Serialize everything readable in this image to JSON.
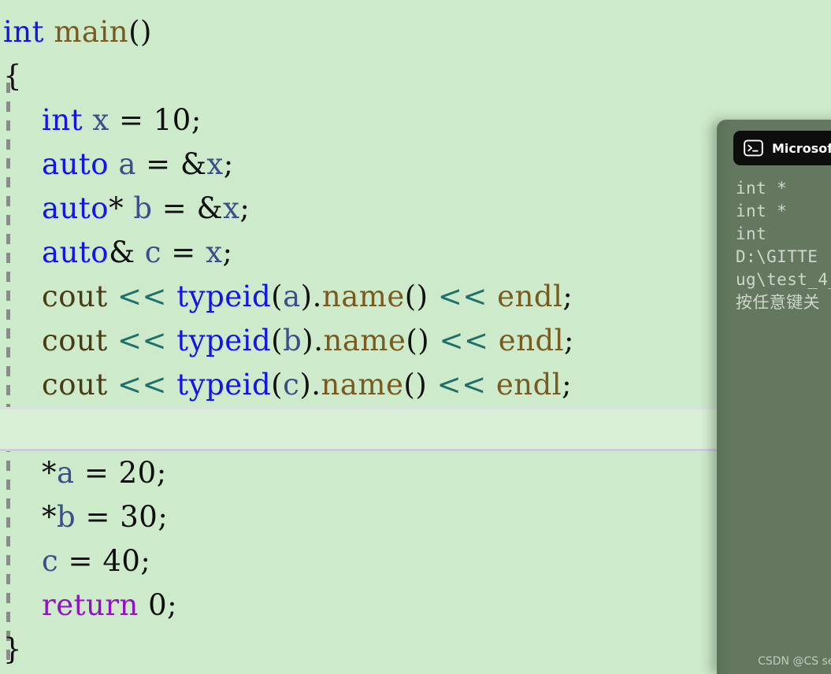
{
  "editor": {
    "background_color": "#cdeaca",
    "current_line_color": "#d9f0d6",
    "lines": [
      {
        "id": "l1",
        "indent": 0,
        "current": false,
        "tokens": [
          {
            "t": "int",
            "c": "k-type"
          },
          {
            "t": " ",
            "c": "op"
          },
          {
            "t": "main",
            "c": "ident"
          },
          {
            "t": "()",
            "c": "punc"
          }
        ]
      },
      {
        "id": "l2",
        "indent": 0,
        "current": false,
        "tokens": [
          {
            "t": "{",
            "c": "punc"
          }
        ]
      },
      {
        "id": "l3",
        "indent": 1,
        "current": false,
        "tokens": [
          {
            "t": "    ",
            "c": "op"
          },
          {
            "t": "int",
            "c": "k-type"
          },
          {
            "t": " ",
            "c": "op"
          },
          {
            "t": "x",
            "c": "var"
          },
          {
            "t": " = ",
            "c": "op"
          },
          {
            "t": "10",
            "c": "num"
          },
          {
            "t": ";",
            "c": "punc"
          }
        ]
      },
      {
        "id": "l4",
        "indent": 1,
        "current": false,
        "tokens": [
          {
            "t": "    ",
            "c": "op"
          },
          {
            "t": "auto",
            "c": "k-type"
          },
          {
            "t": " ",
            "c": "op"
          },
          {
            "t": "a",
            "c": "var"
          },
          {
            "t": " = ",
            "c": "op"
          },
          {
            "t": "&",
            "c": "op"
          },
          {
            "t": "x",
            "c": "var"
          },
          {
            "t": ";",
            "c": "punc"
          }
        ]
      },
      {
        "id": "l5",
        "indent": 1,
        "current": false,
        "tokens": [
          {
            "t": "    ",
            "c": "op"
          },
          {
            "t": "auto",
            "c": "k-type"
          },
          {
            "t": "*",
            "c": "op"
          },
          {
            "t": " ",
            "c": "op"
          },
          {
            "t": "b",
            "c": "var"
          },
          {
            "t": " = ",
            "c": "op"
          },
          {
            "t": "&",
            "c": "op"
          },
          {
            "t": "x",
            "c": "var"
          },
          {
            "t": ";",
            "c": "punc"
          }
        ]
      },
      {
        "id": "l6",
        "indent": 1,
        "current": false,
        "tokens": [
          {
            "t": "    ",
            "c": "op"
          },
          {
            "t": "auto",
            "c": "k-type"
          },
          {
            "t": "&",
            "c": "op"
          },
          {
            "t": " ",
            "c": "op"
          },
          {
            "t": "c",
            "c": "var"
          },
          {
            "t": " = ",
            "c": "op"
          },
          {
            "t": "x",
            "c": "var"
          },
          {
            "t": ";",
            "c": "punc"
          }
        ]
      },
      {
        "id": "l7",
        "indent": 1,
        "current": false,
        "tokens": [
          {
            "t": "    ",
            "c": "op"
          },
          {
            "t": "cout",
            "c": "cout"
          },
          {
            "t": " ",
            "c": "op"
          },
          {
            "t": "<<",
            "c": "shift"
          },
          {
            "t": " ",
            "c": "op"
          },
          {
            "t": "typeid",
            "c": "k-type"
          },
          {
            "t": "(",
            "c": "punc"
          },
          {
            "t": "a",
            "c": "var"
          },
          {
            "t": ")",
            "c": "punc"
          },
          {
            "t": ".",
            "c": "punc"
          },
          {
            "t": "name",
            "c": "ident"
          },
          {
            "t": "()",
            "c": "punc"
          },
          {
            "t": " ",
            "c": "op"
          },
          {
            "t": "<<",
            "c": "shift"
          },
          {
            "t": " ",
            "c": "op"
          },
          {
            "t": "endl",
            "c": "ident"
          },
          {
            "t": ";",
            "c": "punc"
          }
        ]
      },
      {
        "id": "l8",
        "indent": 1,
        "current": false,
        "tokens": [
          {
            "t": "    ",
            "c": "op"
          },
          {
            "t": "cout",
            "c": "cout"
          },
          {
            "t": " ",
            "c": "op"
          },
          {
            "t": "<<",
            "c": "shift"
          },
          {
            "t": " ",
            "c": "op"
          },
          {
            "t": "typeid",
            "c": "k-type"
          },
          {
            "t": "(",
            "c": "punc"
          },
          {
            "t": "b",
            "c": "var"
          },
          {
            "t": ")",
            "c": "punc"
          },
          {
            "t": ".",
            "c": "punc"
          },
          {
            "t": "name",
            "c": "ident"
          },
          {
            "t": "()",
            "c": "punc"
          },
          {
            "t": " ",
            "c": "op"
          },
          {
            "t": "<<",
            "c": "shift"
          },
          {
            "t": " ",
            "c": "op"
          },
          {
            "t": "endl",
            "c": "ident"
          },
          {
            "t": ";",
            "c": "punc"
          }
        ]
      },
      {
        "id": "l9",
        "indent": 1,
        "current": false,
        "tokens": [
          {
            "t": "    ",
            "c": "op"
          },
          {
            "t": "cout",
            "c": "cout"
          },
          {
            "t": " ",
            "c": "op"
          },
          {
            "t": "<<",
            "c": "shift"
          },
          {
            "t": " ",
            "c": "op"
          },
          {
            "t": "typeid",
            "c": "k-type"
          },
          {
            "t": "(",
            "c": "punc"
          },
          {
            "t": "c",
            "c": "var"
          },
          {
            "t": ")",
            "c": "punc"
          },
          {
            "t": ".",
            "c": "punc"
          },
          {
            "t": "name",
            "c": "ident"
          },
          {
            "t": "()",
            "c": "punc"
          },
          {
            "t": " ",
            "c": "op"
          },
          {
            "t": "<<",
            "c": "shift"
          },
          {
            "t": " ",
            "c": "op"
          },
          {
            "t": "endl",
            "c": "ident"
          },
          {
            "t": ";",
            "c": "punc"
          }
        ]
      },
      {
        "id": "l10",
        "indent": 1,
        "current": true,
        "tokens": []
      },
      {
        "id": "l11",
        "indent": 1,
        "current": false,
        "tokens": [
          {
            "t": "    ",
            "c": "op"
          },
          {
            "t": "*",
            "c": "op"
          },
          {
            "t": "a",
            "c": "var"
          },
          {
            "t": " = ",
            "c": "op"
          },
          {
            "t": "20",
            "c": "num"
          },
          {
            "t": ";",
            "c": "punc"
          }
        ]
      },
      {
        "id": "l12",
        "indent": 1,
        "current": false,
        "tokens": [
          {
            "t": "    ",
            "c": "op"
          },
          {
            "t": "*",
            "c": "op"
          },
          {
            "t": "b",
            "c": "var"
          },
          {
            "t": " = ",
            "c": "op"
          },
          {
            "t": "30",
            "c": "num"
          },
          {
            "t": ";",
            "c": "punc"
          }
        ]
      },
      {
        "id": "l13",
        "indent": 1,
        "current": false,
        "tokens": [
          {
            "t": "    ",
            "c": "op"
          },
          {
            "t": "c",
            "c": "var"
          },
          {
            "t": " = ",
            "c": "op"
          },
          {
            "t": "40",
            "c": "num"
          },
          {
            "t": ";",
            "c": "punc"
          }
        ]
      },
      {
        "id": "l14",
        "indent": 1,
        "current": false,
        "tokens": [
          {
            "t": "    ",
            "c": "op"
          },
          {
            "t": "return",
            "c": "k-return"
          },
          {
            "t": " ",
            "c": "op"
          },
          {
            "t": "0",
            "c": "num"
          },
          {
            "t": ";",
            "c": "punc"
          }
        ]
      },
      {
        "id": "l15",
        "indent": 0,
        "current": false,
        "tokens": [
          {
            "t": "}",
            "c": "punc"
          }
        ]
      }
    ]
  },
  "console": {
    "icon": "terminal-icon",
    "title": "Microsoft",
    "titlebar_color": "#0d0d0d",
    "body_color": "#63785f",
    "lines": [
      "int *",
      "int *",
      "int",
      "",
      "D:\\GITTE ",
      "ug\\test_4_",
      "按任意键关"
    ]
  },
  "watermark": {
    "text": "CSDN @CS semi"
  }
}
